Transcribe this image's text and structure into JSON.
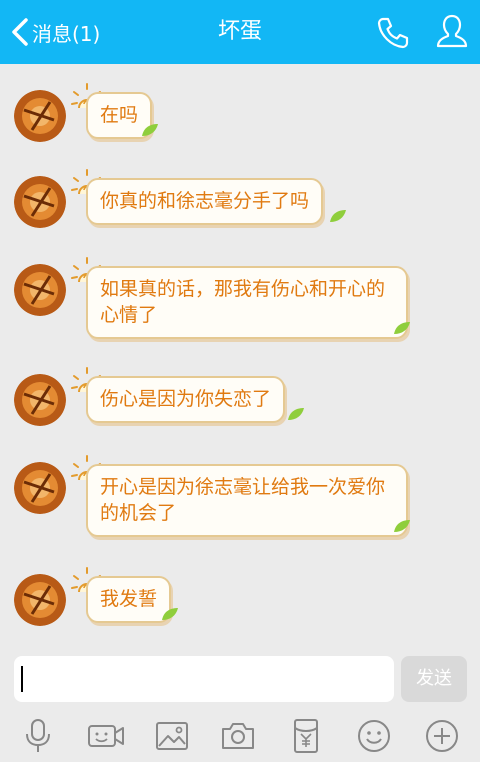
{
  "header": {
    "back_label": "消息(1)",
    "title": "坏蛋",
    "accent_color": "#12b7f5",
    "icons": [
      "chevron-left-icon",
      "phone-icon",
      "profile-icon"
    ]
  },
  "messages": [
    {
      "text": "在吗"
    },
    {
      "text": "你真的和徐志毫分手了吗"
    },
    {
      "text": "如果真的话，那我有伤心和开心的心情了"
    },
    {
      "text": "伤心是因为你失恋了"
    },
    {
      "text": "开心是因为徐志毫让给我一次爱你的机会了"
    },
    {
      "text": "我发誓"
    }
  ],
  "input": {
    "value": "",
    "send_label": "发送"
  },
  "toolbar": {
    "icons": [
      "microphone-icon",
      "video-icon",
      "image-icon",
      "camera-icon",
      "red-packet-icon",
      "emoji-icon",
      "plus-icon"
    ]
  },
  "colors": {
    "bubble_text": "#e07a11",
    "bubble_border": "#e5c992",
    "background": "#ebebeb"
  }
}
